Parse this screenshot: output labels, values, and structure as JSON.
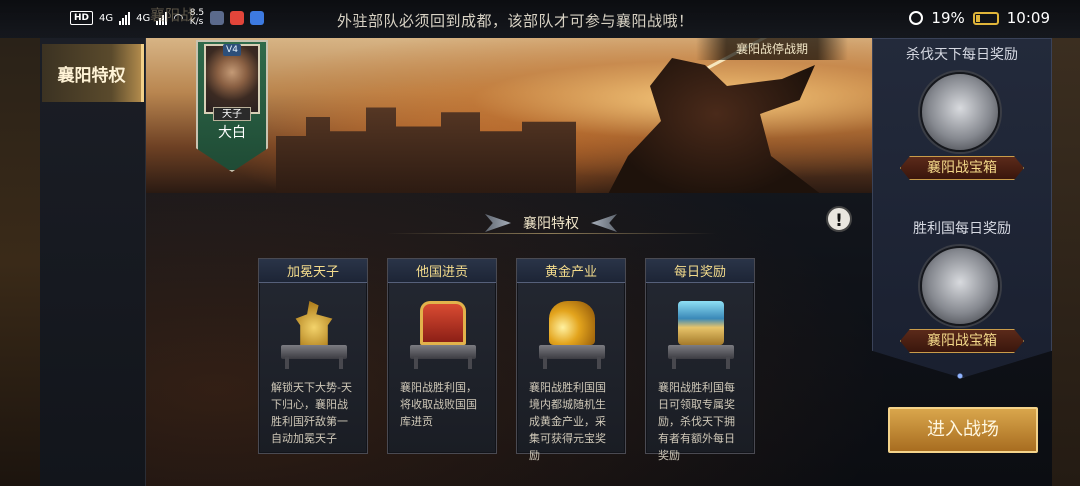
{
  "status_bar": {
    "hd": "HD",
    "net1": "4G",
    "net2": "4G",
    "speed_value": "8.5",
    "speed_unit": "K/s",
    "battery": "19%",
    "time": "10:09",
    "battery_level": 0.19
  },
  "scroll_message": "外驻部队必须回到成都，该部队才可参与襄阳战哦！",
  "ghost_title": "襄阳战",
  "left_nav": {
    "tabs": [
      {
        "label": "襄阳特权",
        "active": true
      }
    ]
  },
  "banner": {
    "period": "襄阳战停战期"
  },
  "ruler": {
    "vip": "V4",
    "title": "天子",
    "name": "大白"
  },
  "section": {
    "title": "襄阳特权",
    "help_icon": "!"
  },
  "cards": [
    {
      "title": "加冕天子",
      "icon": "jade-seal-icon",
      "desc": "解锁天下大势-天下归心，襄阳战胜利国歼敌第一自动加冕天子"
    },
    {
      "title": "他国进贡",
      "icon": "treasure-chest-icon",
      "desc": "襄阳战胜利国，将收取战败国国库进贡"
    },
    {
      "title": "黄金产业",
      "icon": "gold-ingots-icon",
      "desc": "襄阳战胜利国国境内都城随机生成黄金产业，采集可获得元宝奖励"
    },
    {
      "title": "每日奖励",
      "icon": "reward-box-icon",
      "desc": "襄阳战胜利国每日可领取专属奖励，杀伐天下拥有者有额外每日奖励"
    }
  ],
  "rewards": [
    {
      "title": "杀伐天下每日奖励",
      "chest_label": "襄阳战宝箱"
    },
    {
      "title": "胜利国每日奖励",
      "chest_label": "襄阳战宝箱"
    }
  ],
  "enter_button": "进入战场"
}
